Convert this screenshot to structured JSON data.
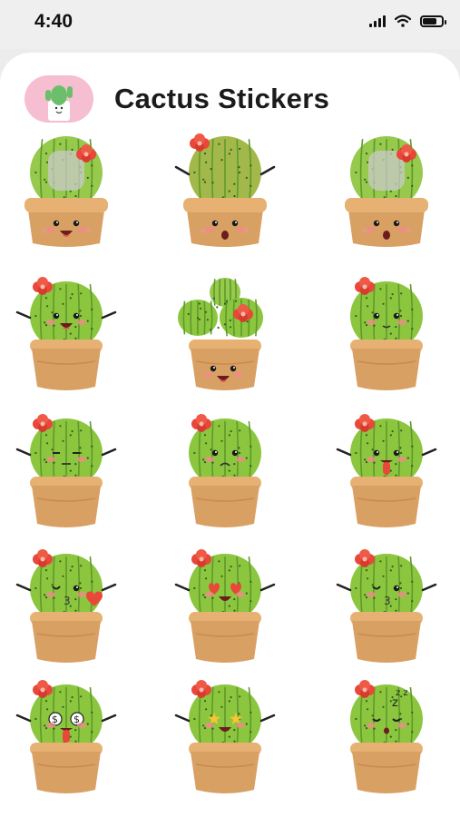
{
  "status_bar": {
    "time": "4:40",
    "icons": [
      "cellular-signal-icon",
      "wifi-icon",
      "battery-icon"
    ]
  },
  "header": {
    "title": "Cactus Stickers",
    "icon": "cactus-pack-icon"
  },
  "colors": {
    "sheet": "#ffffff",
    "backdrop": "#ececec",
    "pack_icon_bg": "#f6bfd1",
    "cactus_green": "#8cc63f",
    "pot_tan": "#dca56b",
    "flower_red": "#e8473a"
  },
  "stickers": [
    {
      "name": "cactus-sticker-tall-plain"
    },
    {
      "name": "cactus-sticker-tall-shocked"
    },
    {
      "name": "cactus-sticker-tall-surprised"
    },
    {
      "name": "cactus-sticker-waving-happy"
    },
    {
      "name": "cactus-sticker-triple-laughing"
    },
    {
      "name": "cactus-sticker-shy"
    },
    {
      "name": "cactus-sticker-unamused"
    },
    {
      "name": "cactus-sticker-sad"
    },
    {
      "name": "cactus-sticker-tongue-out"
    },
    {
      "name": "cactus-sticker-kiss-heart"
    },
    {
      "name": "cactus-sticker-heart-eyes"
    },
    {
      "name": "cactus-sticker-kissing"
    },
    {
      "name": "cactus-sticker-money-eyes"
    },
    {
      "name": "cactus-sticker-star-eyes"
    },
    {
      "name": "cactus-sticker-sleeping"
    }
  ]
}
